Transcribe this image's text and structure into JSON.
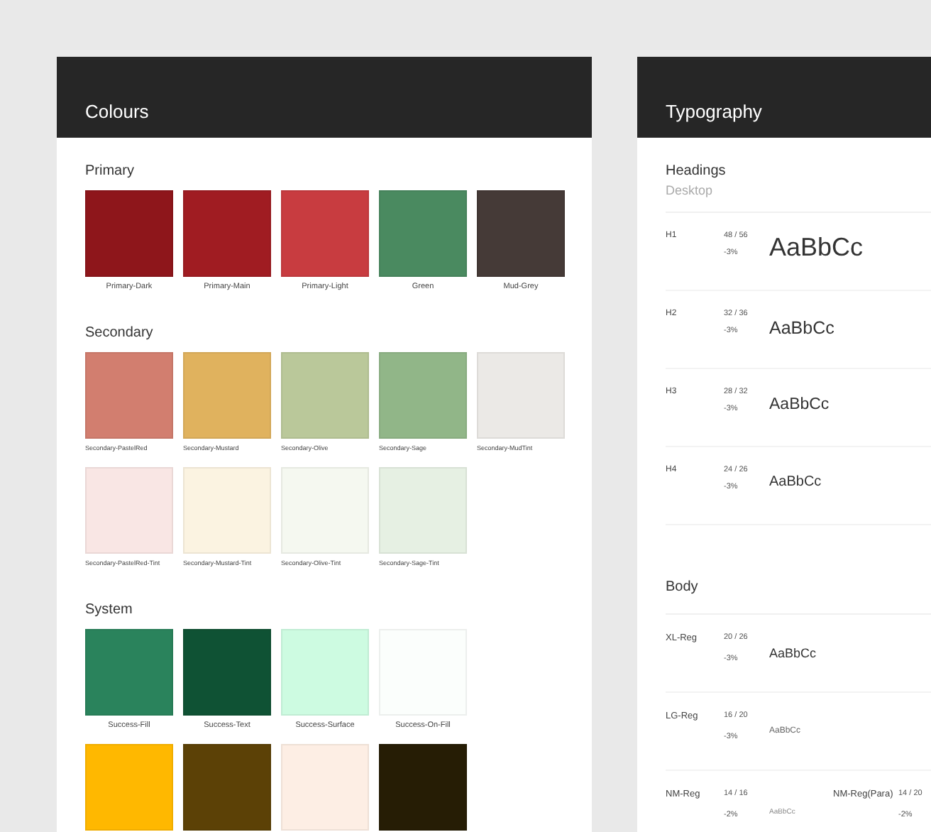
{
  "colours": {
    "title": "Colours",
    "sections": [
      {
        "title": "Primary",
        "kind": "centered",
        "rows": [
          [
            {
              "name": "Primary-Dark",
              "color": "#8e161b"
            },
            {
              "name": "Primary-Main",
              "color": "#a01c22"
            },
            {
              "name": "Primary-Light",
              "color": "#c83c40"
            },
            {
              "name": "Green",
              "color": "#4a8a60"
            },
            {
              "name": "Mud-Grey",
              "color": "#453a37"
            }
          ]
        ]
      },
      {
        "title": "Secondary",
        "kind": "small",
        "rows": [
          [
            {
              "name": "Secondary-PastelRed",
              "color": "#d27e6f"
            },
            {
              "name": "Secondary-Mustard",
              "color": "#e0b25e"
            },
            {
              "name": "Secondary-Olive",
              "color": "#bac89a"
            },
            {
              "name": "Secondary-Sage",
              "color": "#91b688"
            },
            {
              "name": "Secondary-MudTint",
              "color": "#ebe9e6"
            }
          ],
          [
            {
              "name": "Secondary-PastelRed-Tint",
              "color": "#f9e6e4"
            },
            {
              "name": "Secondary-Mustard-Tint",
              "color": "#fbf3e1"
            },
            {
              "name": "Secondary-Olive-Tint",
              "color": "#f5f8f0"
            },
            {
              "name": "Secondary-Sage-Tint",
              "color": "#e6f0e3"
            }
          ]
        ]
      },
      {
        "title": "System",
        "kind": "centered",
        "rows": [
          [
            {
              "name": "Success-Fill",
              "color": "#2a835c"
            },
            {
              "name": "Success-Text",
              "color": "#0f5234"
            },
            {
              "name": "Success-Surface",
              "color": "#cdfbe1"
            },
            {
              "name": "Success-On-Fill",
              "color": "#fbfefc"
            }
          ],
          [
            {
              "color": "#ffb800"
            },
            {
              "color": "#5c4106"
            },
            {
              "color": "#fdeee4"
            },
            {
              "color": "#261d05"
            }
          ]
        ]
      }
    ]
  },
  "typography": {
    "title": "Typography",
    "sections": [
      {
        "title": "Headings",
        "subtitle": "Desktop",
        "rows": [
          {
            "kind": "h1",
            "label": "H1",
            "size": "48 / 56",
            "tracking": "-3%",
            "sample": "AaBbCc"
          },
          {
            "kind": "h2",
            "label": "H2",
            "size": "32 / 36",
            "tracking": "-3%",
            "sample": "AaBbCc"
          },
          {
            "kind": "h3",
            "label": "H3",
            "size": "28 / 32",
            "tracking": "-3%",
            "sample": "AaBbCc"
          },
          {
            "kind": "h4",
            "label": "H4",
            "size": "24 / 26",
            "tracking": "-3%",
            "sample": "AaBbCc"
          }
        ]
      },
      {
        "title": "Body",
        "rows": [
          {
            "kind": "xl",
            "label": "XL-Reg",
            "size": "20 / 26",
            "tracking": "-3%",
            "sample": "AaBbCc"
          },
          {
            "kind": "lg",
            "label": "LG-Reg",
            "size": "16 / 20",
            "tracking": "-3%",
            "sample": "AaBbCc"
          },
          {
            "kind": "nm",
            "label": "NM-Reg",
            "size": "14 / 16",
            "tracking": "-2%",
            "sample": "AaBbCc",
            "extra": {
              "label": "NM-Reg(Para)",
              "size": "14 / 20",
              "tracking": "-2%"
            }
          }
        ]
      }
    ]
  }
}
